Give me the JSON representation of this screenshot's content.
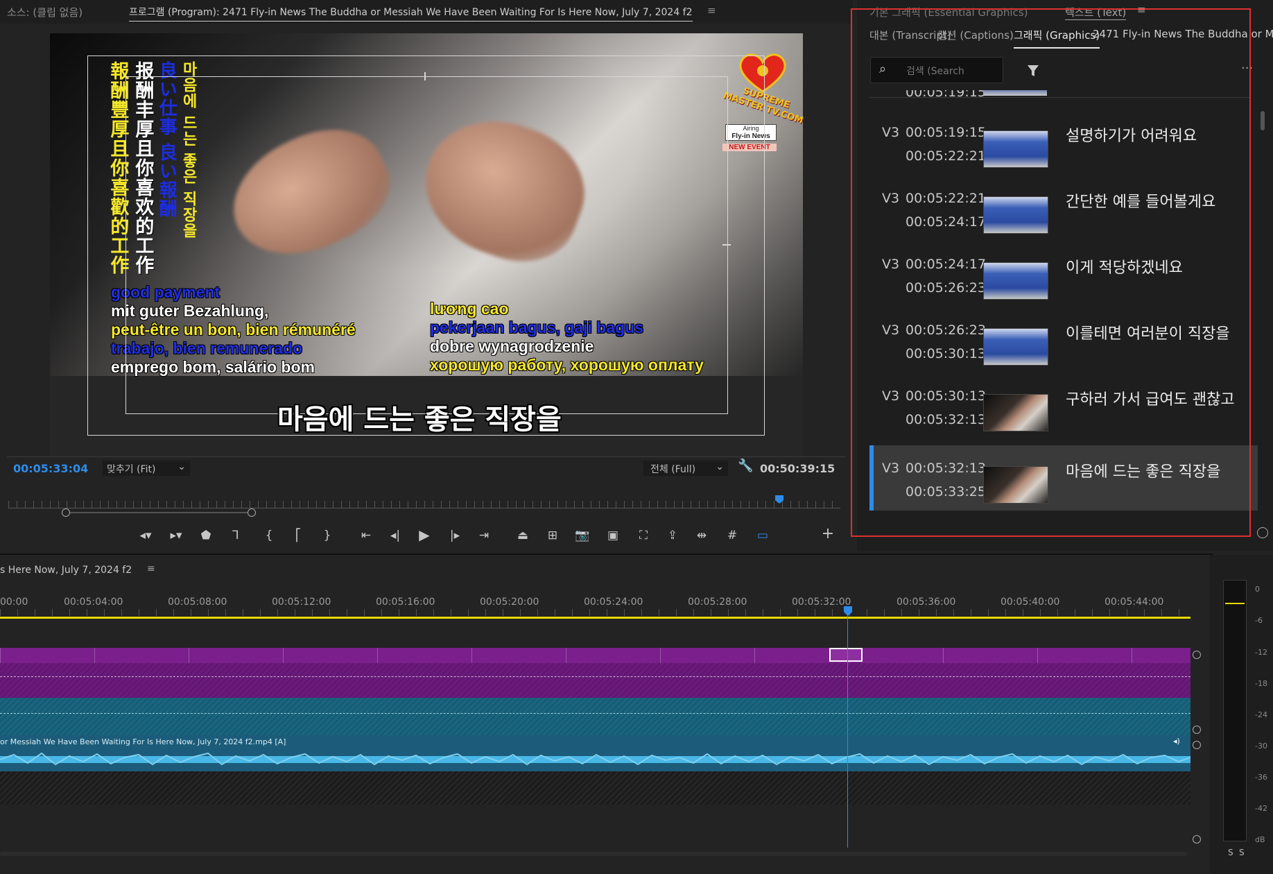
{
  "source_monitor": {
    "label": "소스: (클립 없음)"
  },
  "program_monitor": {
    "title": "프로그램 (Program): 2471 Fly-in News The Buddha or Messiah We Have Been Waiting For Is Here Now, July 7, 2024 f2",
    "menu_glyph": "≡",
    "current_timecode": "00:05:33:04",
    "zoom": "맞추기 (Fit)",
    "resolution": "전체 (Full)",
    "duration_timecode": "00:50:39:15"
  },
  "video_frame": {
    "vertical_text": [
      {
        "text": "報酬豐厚且你喜歡的工作",
        "color": "#f6e82a"
      },
      {
        "text": "报酬丰厚且你喜欢的工作",
        "color": "#ffffff"
      },
      {
        "text": "良い仕事 良い報酬",
        "color": "#1c2de0"
      },
      {
        "text": "마음에 드는 좋은 직장을",
        "color": "#f6e82a"
      }
    ],
    "left_subtitles": [
      {
        "text": "good payment",
        "color": "#1f2ee6"
      },
      {
        "text": "mit guter Bezahlung,",
        "color": "#ffffff"
      },
      {
        "text": "peut-être un bon, bien rémunéré",
        "color": "#f6e82a"
      },
      {
        "text": "trabajo, bien remunerado",
        "color": "#1f2ee6"
      },
      {
        "text": "emprego bom, salário bom",
        "color": "#ffffff"
      }
    ],
    "right_subtitles": [
      {
        "text": "lương cao",
        "color": "#f6e82a"
      },
      {
        "text": "pekerjaan bagus, gaji bagus",
        "color": "#1f2ee6"
      },
      {
        "text": "dobre wynagrodzenie",
        "color": "#ffffff"
      },
      {
        "text": "хорошую работу, хорошую оплату",
        "color": "#f6e82a"
      }
    ],
    "logo_text": "SUPREME MASTER TV.COM",
    "badge_line1": "Airing",
    "badge_line2": "Fly-in News",
    "badge_line3": "NEW EVENT",
    "caption": "마음에 드는 좋은 직장을"
  },
  "right_panel": {
    "tab_top_left": "기본 그래픽 (Essential Graphics)",
    "tab_top_right": "텍스트 (Text)",
    "tabs": [
      {
        "label": "대본 (Transcript)"
      },
      {
        "label": "캡션 (Captions)"
      },
      {
        "label": "그래픽 (Graphics)"
      },
      {
        "label": "2471 Fly-in News The Buddha or M..."
      }
    ],
    "search_placeholder": "검색 (Search",
    "more_glyph": "···",
    "partial_row_time": "00:05:19:15",
    "captions": [
      {
        "track": "V3",
        "in": "00:05:19:15",
        "out": "00:05:22:21",
        "text": "설명하기가 어려워요",
        "thumb": "news",
        "selected": false
      },
      {
        "track": "V3",
        "in": "00:05:22:21",
        "out": "00:05:24:17",
        "text": "간단한 예를 들어볼게요",
        "thumb": "news",
        "selected": false
      },
      {
        "track": "V3",
        "in": "00:05:24:17",
        "out": "00:05:26:23",
        "text": "이게 적당하겠네요",
        "thumb": "news",
        "selected": false
      },
      {
        "track": "V3",
        "in": "00:05:26:23",
        "out": "00:05:30:13",
        "text": "이를테면 여러분이 직장을",
        "thumb": "news",
        "selected": false
      },
      {
        "track": "V3",
        "in": "00:05:30:13",
        "out": "00:05:32:13",
        "text": "구하러 가서 급여도 괜찮고",
        "thumb": "hand",
        "selected": false
      },
      {
        "track": "V3",
        "in": "00:05:32:13",
        "out": "00:05:33:25",
        "text": "마음에 드는 좋은 직장을",
        "thumb": "hand",
        "selected": true
      }
    ]
  },
  "timeline": {
    "sequence_name": "s Here Now, July 7, 2024 f2",
    "menu_glyph": "≡",
    "ruler": [
      "00:00",
      "00:05:04:00",
      "00:05:08:00",
      "00:05:12:00",
      "00:05:16:00",
      "00:05:20:00",
      "00:05:24:00",
      "00:05:28:00",
      "00:05:32:00",
      "00:05:36:00",
      "00:05:40:00",
      "00:05:44:00"
    ],
    "audio_clip_name": "or Messiah We Have Been Waiting For Is Here Now, July 7, 2024 f2.mp4 [A]",
    "colors": {
      "video_track": "#7a1f8c",
      "audio_track": "#1c6b8a",
      "playhead": "#2d8ceb",
      "work_area": "#e6d800"
    }
  },
  "audio_meter": {
    "scale": [
      "0",
      "-6",
      "-12",
      "-18",
      "-24",
      "-30",
      "-36",
      "-42",
      "dB"
    ],
    "solo_left": "S",
    "solo_right": "S"
  }
}
